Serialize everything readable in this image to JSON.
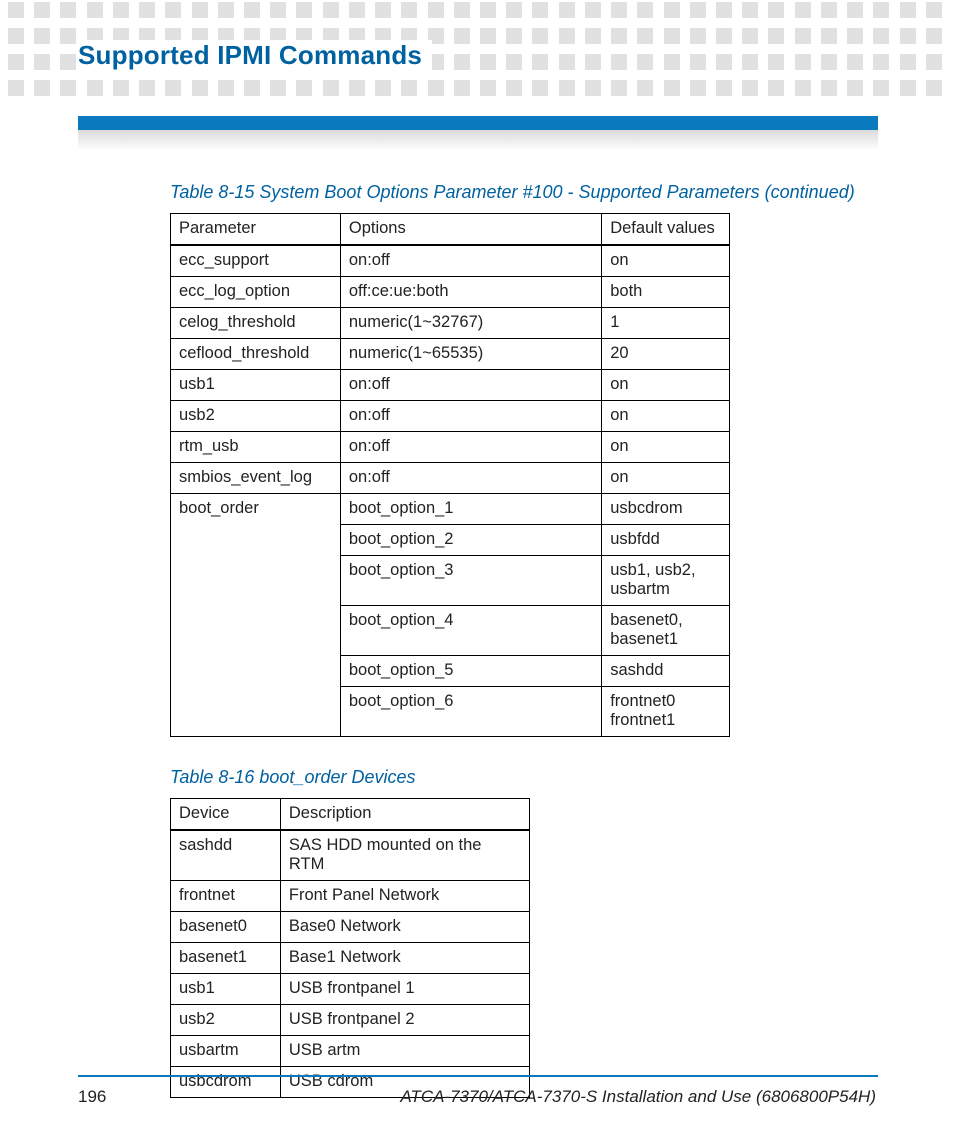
{
  "header": {
    "title": "Supported IPMI Commands"
  },
  "table1": {
    "caption": "Table 8-15 System Boot Options Parameter #100 - Supported Parameters  (continued)",
    "head": {
      "c1": "Parameter",
      "c2": "Options",
      "c3": "Default values"
    },
    "rows_simple": [
      {
        "c1": "ecc_support",
        "c2": "on:off",
        "c3": "on"
      },
      {
        "c1": "ecc_log_option",
        "c2": "off:ce:ue:both",
        "c3": "both"
      },
      {
        "c1": "celog_threshold",
        "c2": "numeric(1~32767)",
        "c3": "1"
      },
      {
        "c1": "ceflood_threshold",
        "c2": "numeric(1~65535)",
        "c3": "20"
      },
      {
        "c1": "usb1",
        "c2": "on:off",
        "c3": "on"
      },
      {
        "c1": "usb2",
        "c2": "on:off",
        "c3": "on"
      },
      {
        "c1": "rtm_usb",
        "c2": "on:off",
        "c3": "on"
      },
      {
        "c1": "smbios_event_log",
        "c2": "on:off",
        "c3": "on"
      }
    ],
    "boot_order": {
      "param": "boot_order",
      "opts": [
        {
          "o": "boot_option_1",
          "d": "usbcdrom"
        },
        {
          "o": "boot_option_2",
          "d": "usbfdd"
        },
        {
          "o": "boot_option_3",
          "d": "usb1, usb2, usbartm"
        },
        {
          "o": "boot_option_4",
          "d": "basenet0, basenet1"
        },
        {
          "o": "boot_option_5",
          "d": "sashdd"
        },
        {
          "o": "boot_option_6",
          "d": "frontnet0\nfrontnet1"
        }
      ]
    }
  },
  "table2": {
    "caption": "Table 8-16 boot_order Devices",
    "head": {
      "c1": "Device",
      "c2": "Description"
    },
    "rows": [
      {
        "c1": "sashdd",
        "c2": "SAS HDD mounted on the RTM"
      },
      {
        "c1": "frontnet",
        "c2": "Front Panel Network"
      },
      {
        "c1": "basenet0",
        "c2": "Base0 Network"
      },
      {
        "c1": "basenet1",
        "c2": "Base1 Network"
      },
      {
        "c1": "usb1",
        "c2": "USB frontpanel 1"
      },
      {
        "c1": "usb2",
        "c2": "USB frontpanel 2"
      },
      {
        "c1": "usbartm",
        "c2": "USB artm"
      },
      {
        "c1": "usbcdrom",
        "c2": "USB cdrom"
      }
    ]
  },
  "footer": {
    "page": "196",
    "right": "ATCA-7370/ATCA-7370-S Installation and Use (6806800P54H)"
  }
}
